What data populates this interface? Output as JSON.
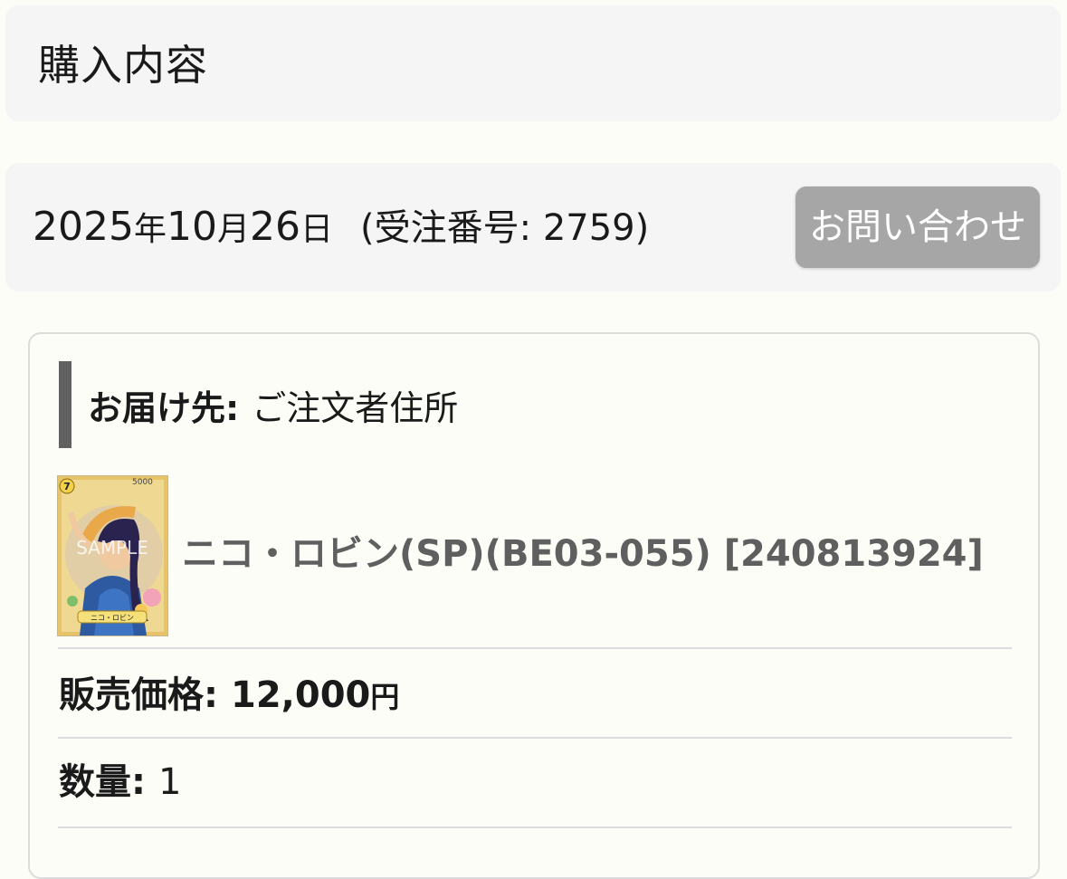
{
  "page": {
    "title": "購入内容"
  },
  "order": {
    "year": "2025",
    "year_unit": "年",
    "month": "10",
    "month_unit": "月",
    "day": "26",
    "day_unit": "日",
    "order_number_text": "(受注番号: 2759)",
    "inquiry_button": "お問い合わせ"
  },
  "shipping": {
    "label": "お届け先:",
    "value": "ご注文者住所"
  },
  "product": {
    "name": "ニコ・ロビン(SP)(BE03-055) [240813924]",
    "thumbnail": {
      "cost": "7",
      "power": "5000",
      "watermark": "SAMPLE",
      "card_name": "ニコ・ロビン"
    }
  },
  "price": {
    "label": "販売価格:",
    "value": "12,000",
    "unit": "円"
  },
  "quantity": {
    "label": "数量:",
    "value": "1"
  },
  "colors": {
    "page_bg": "#fdfdf8",
    "panel_bg": "#f5f5f5",
    "button_bg": "#a6a6a6",
    "accent_bar": "#616161",
    "product_text": "#5f5f5f"
  }
}
